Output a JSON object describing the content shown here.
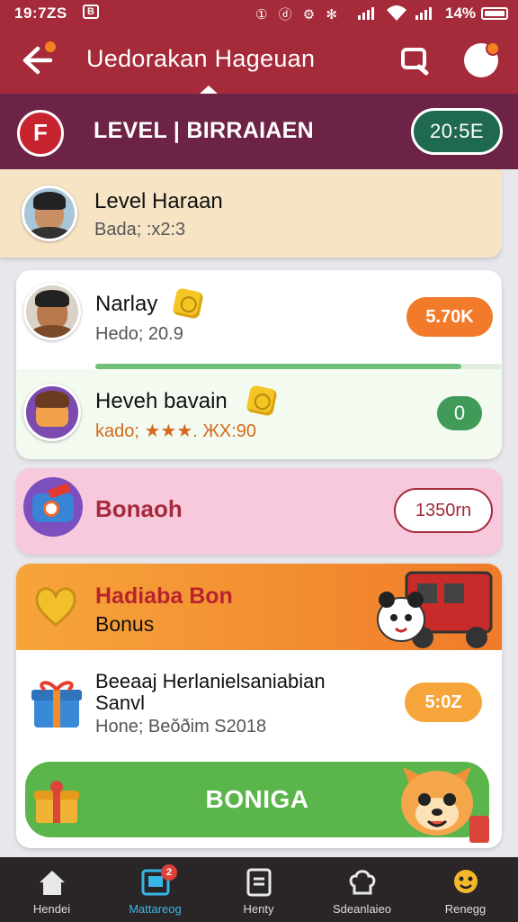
{
  "status_bar": {
    "time": "19:7ZS",
    "mail_badge": "B",
    "status_icons": "① ⓓ ⚙ ✻",
    "battery": "14%"
  },
  "app_bar": {
    "title": "Uedorakan Hageuan",
    "back_icon": "back-arrow-icon",
    "search_icon": "search-icon",
    "profile_icon": "profile-icon"
  },
  "level_header": {
    "title": "LEVEL | BIRRAIAEN",
    "timer": "20:5E",
    "logo_glyph": "F"
  },
  "level_card": {
    "name": "Level Haraan",
    "sub": "Bada; :x2:3"
  },
  "players": [
    {
      "name": "Narlay",
      "sub": "Hedo; 20.9",
      "badge": "5.70K",
      "badge_color": "#f27a2b",
      "progress": 0.9
    },
    {
      "name": "Heveh bavain",
      "sub": "kado; ★★★. ЖX:90",
      "badge": "0",
      "badge_color": "#3f9b57"
    }
  ],
  "bonus_pink": {
    "title": "Bonaoh",
    "badge": "1350rn"
  },
  "bonus_orange": {
    "title": "Hadiaba Bon",
    "subtitle": "Bonus"
  },
  "reward": {
    "title_line1": "Beeaaj Herlanielsaniabian",
    "title_line2": "Sanvl",
    "sub": "Hone; Beŏðim S2018",
    "badge": "5:0Z"
  },
  "cta": {
    "label": "BONIGA"
  },
  "bottom_nav": [
    {
      "label": "Hendei",
      "icon": "home-icon"
    },
    {
      "label": "Mattareog",
      "icon": "tablet-icon",
      "badge": "2",
      "active": true
    },
    {
      "label": "Henty",
      "icon": "document-icon"
    },
    {
      "label": "Sdeanlaieo",
      "icon": "chef-hat-icon"
    },
    {
      "label": "Renegg",
      "icon": "smiley-icon"
    }
  ]
}
